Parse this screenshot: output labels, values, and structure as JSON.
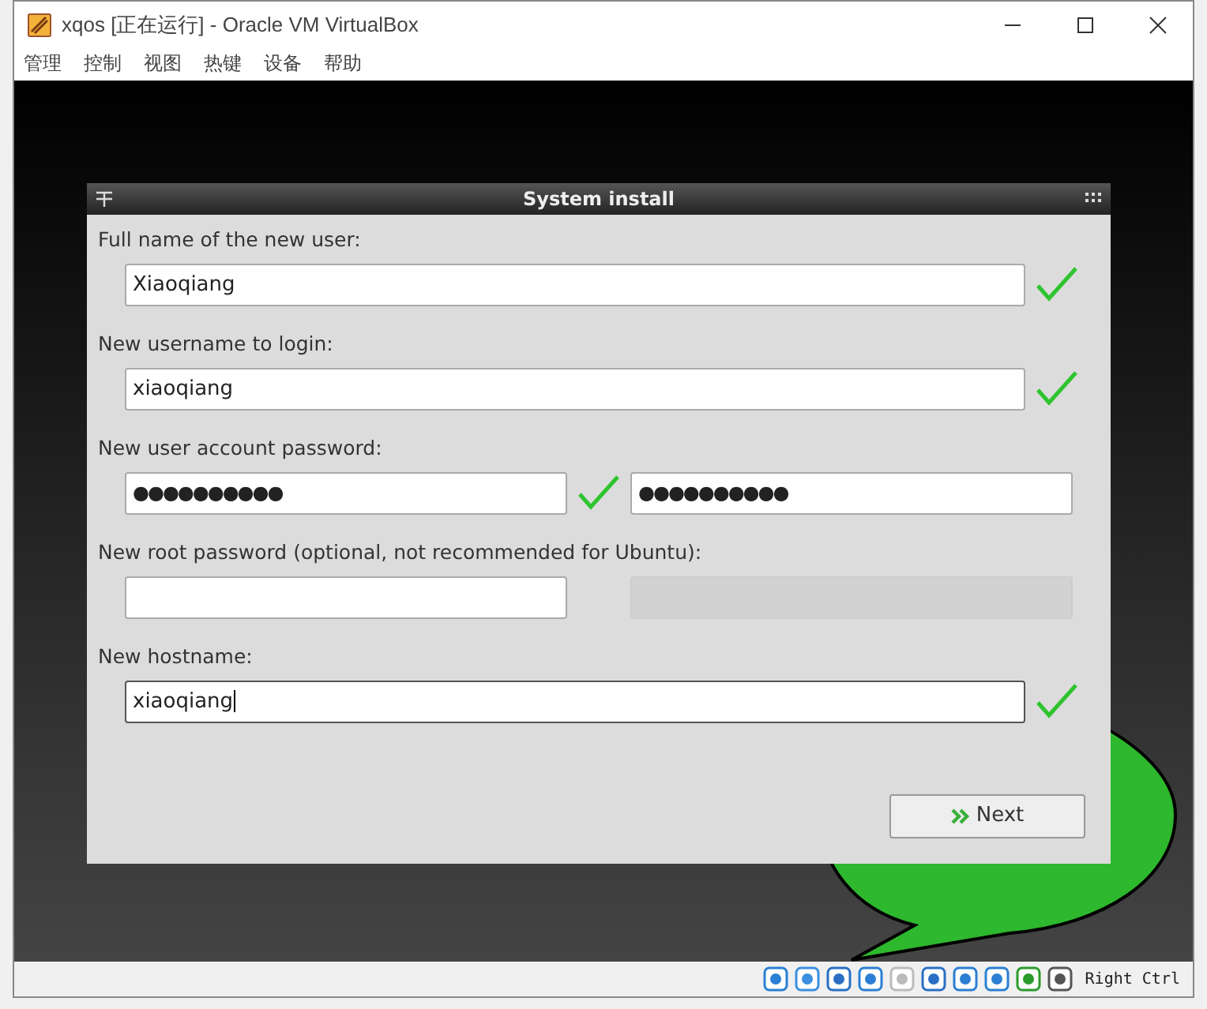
{
  "window": {
    "title": "xqos [正在运行] - Oracle VM VirtualBox"
  },
  "menu": [
    "管理",
    "控制",
    "视图",
    "热键",
    "设备",
    "帮助"
  ],
  "dialog": {
    "title": "System install",
    "fields": [
      {
        "label": "Full name of the new user:",
        "inputs": [
          {
            "kind": "text",
            "value": "Xiaoqiang",
            "valid": true,
            "disabled": false,
            "focused": false
          }
        ]
      },
      {
        "label": "New username to login:",
        "inputs": [
          {
            "kind": "text",
            "value": "xiaoqiang",
            "valid": true,
            "disabled": false,
            "focused": false
          }
        ]
      },
      {
        "label": "New user account password:",
        "inputs": [
          {
            "kind": "password",
            "value": "●●●●●●●●●●",
            "valid": true,
            "disabled": false,
            "focused": false
          },
          {
            "kind": "password",
            "value": "●●●●●●●●●●",
            "valid": false,
            "disabled": false,
            "focused": false
          }
        ]
      },
      {
        "label": "New root password (optional, not recommended for Ubuntu):",
        "inputs": [
          {
            "kind": "password",
            "valid": false,
            "disabled": false,
            "focused": false
          },
          {
            "kind": "password",
            "valid": false,
            "disabled": true,
            "focused": false
          }
        ]
      },
      {
        "label": "New hostname:",
        "inputs": [
          {
            "kind": "text",
            "value": "xiaoqiang",
            "valid": true,
            "disabled": false,
            "focused": true
          }
        ]
      }
    ],
    "next_button": {
      "label": "Next"
    }
  },
  "status_bar": {
    "host_key": "Right Ctrl"
  }
}
